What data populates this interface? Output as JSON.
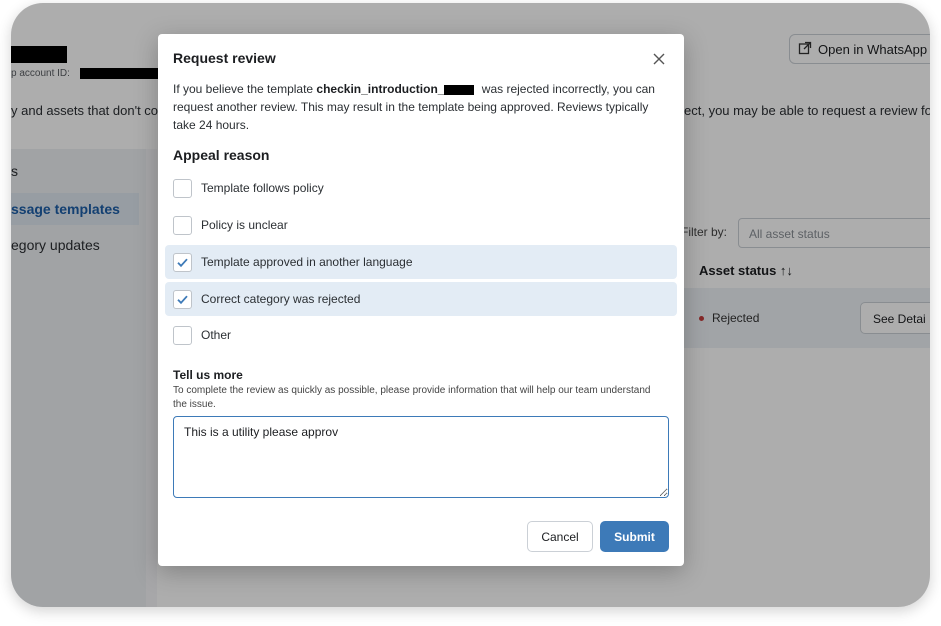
{
  "background": {
    "account_id_label": "p account ID:",
    "notice_left": "y and assets that don't co",
    "notice_right": "ect, you may be able to request a review for",
    "open_whatsapp_label": "Open in WhatsApp",
    "sidebar": {
      "items": [
        {
          "label": "s"
        },
        {
          "label": "ssage templates"
        },
        {
          "label": "egory updates"
        }
      ]
    },
    "filter": {
      "label": "Filter by:",
      "selected": "All asset status"
    },
    "table": {
      "column_header": "Asset status ↑↓",
      "rows": [
        {
          "status": "Rejected",
          "action": "See Detai"
        }
      ]
    }
  },
  "modal": {
    "title": "Request review",
    "description": {
      "prefix": "If you believe the template ",
      "template_name": "checkin_introduction_",
      "suffix": " was rejected incorrectly, you can request another review. This may result in the template being approved. Reviews typically take 24 hours."
    },
    "appeal_title": "Appeal reason",
    "options": [
      {
        "label": "Template follows policy",
        "checked": false
      },
      {
        "label": "Policy is unclear",
        "checked": false
      },
      {
        "label": "Template approved in another language",
        "checked": true
      },
      {
        "label": "Correct category was rejected",
        "checked": true
      },
      {
        "label": "Other",
        "checked": false
      }
    ],
    "tell_more": {
      "title": "Tell us more",
      "subtitle": "To complete the review as quickly as possible, please provide information that will help our team understand the issue.",
      "value": "This is a utility please approv"
    },
    "cancel_label": "Cancel",
    "submit_label": "Submit"
  },
  "colors": {
    "accent": "#3d7ab8",
    "checked_row": "#e3ecf5",
    "rejected_dot": "#c43b3b"
  }
}
